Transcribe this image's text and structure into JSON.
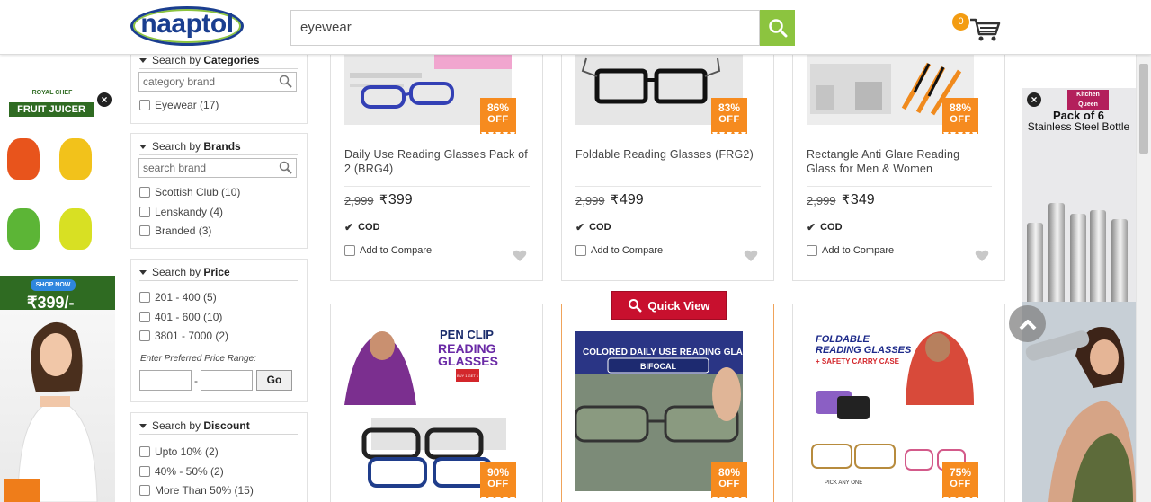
{
  "header": {
    "logo_text": "naaptol",
    "search_value": "eyewear",
    "cart_count": "0"
  },
  "sidebar": {
    "categories": {
      "title_prefix": "Search by",
      "title_bold": "Categories",
      "input_placeholder": "category brand",
      "options": [
        "Eyewear (17)"
      ]
    },
    "brands": {
      "title_prefix": "Search by",
      "title_bold": "Brands",
      "input_placeholder": "search brand",
      "options": [
        "Scottish Club (10)",
        "Lenskandy (4)",
        "Branded (3)"
      ]
    },
    "price": {
      "title_prefix": "Search by",
      "title_bold": "Price",
      "options": [
        "201 - 400 (5)",
        "401 - 600 (10)",
        "3801 - 7000 (2)"
      ],
      "range_label": "Enter Preferred Price Range:",
      "range_dash": "-",
      "go_label": "Go"
    },
    "discount": {
      "title_prefix": "Search by",
      "title_bold": "Discount",
      "options": [
        "Upto 10% (2)",
        "40% - 50% (2)",
        "More Than 50% (15)"
      ]
    }
  },
  "products": [
    {
      "name": "Daily Use Reading Glasses Pack of 2 (BRG4)",
      "mrp": "2,999",
      "price": "399",
      "discount": "86%",
      "off": "OFF",
      "cod": "COD",
      "compare": "Add to Compare"
    },
    {
      "name": "Foldable Reading Glasses (FRG2)",
      "mrp": "2,999",
      "price": "499",
      "discount": "83%",
      "off": "OFF",
      "cod": "COD",
      "compare": "Add to Compare"
    },
    {
      "name": "Rectangle Anti Glare Reading Glass for Men & Women",
      "mrp": "2,999",
      "price": "349",
      "discount": "88%",
      "off": "OFF",
      "cod": "COD",
      "compare": "Add to Compare"
    },
    {
      "discount": "90%",
      "off": "OFF",
      "image_text": [
        "PEN CLIP",
        "READING",
        "GLASSES",
        "BUY 1 GET 1 FREE"
      ]
    },
    {
      "discount": "80%",
      "off": "OFF",
      "image_text": [
        "COLORED DAILY USE READING GLASSES",
        "BIFOCAL"
      ]
    },
    {
      "discount": "75%",
      "off": "OFF",
      "image_text": [
        "FOLDABLE",
        "READING GLASSES",
        "+ SAFETY CARRY CASE",
        "PICK ANY ONE"
      ]
    }
  ],
  "currency_symbol": "₹",
  "quick_view_label": "Quick View",
  "left_ad": {
    "brand": "ROYAL CHEF",
    "title": "FRUIT JUICER",
    "shop_now": "SHOP NOW",
    "price": "₹399/-",
    "close": "×"
  },
  "right_ad": {
    "brand": "Kitchen Queen",
    "title_line1": "Pack of 6",
    "title_line2": "Stainless Steel Bottle",
    "close": "×"
  },
  "colors": {
    "brand_green": "#8cc43f",
    "brand_blue": "#1a3e8f",
    "discount_orange": "#f68b1f",
    "quick_view_red": "#c8102e"
  }
}
